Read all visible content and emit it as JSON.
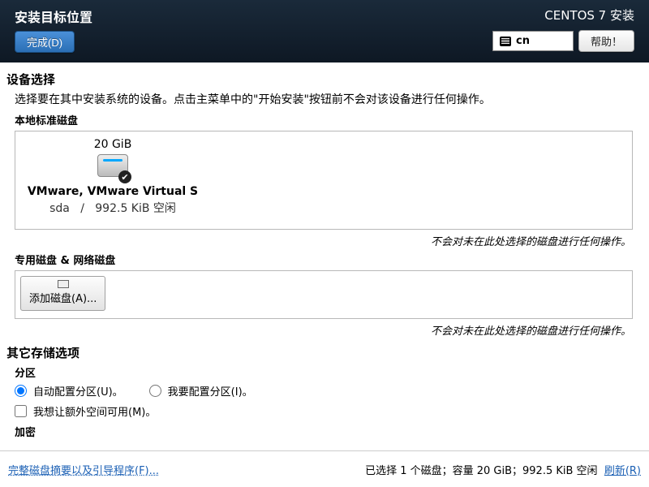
{
  "header": {
    "title": "安装目标位置",
    "done_btn": "完成(D)",
    "product": "CENTOS 7 安装",
    "lang": "cn",
    "help_btn": "帮助！"
  },
  "device_selection": {
    "heading": "设备选择",
    "instruction": "选择要在其中安装系统的设备。点击主菜单中的\"开始安装\"按钮前不会对该设备进行任何操作。",
    "local_heading": "本地标准磁盘",
    "disk": {
      "size": "20 GiB",
      "name": "VMware, VMware Virtual S",
      "dev": "sda",
      "sep": "/",
      "free": "992.5 KiB 空闲"
    },
    "note": "不会对未在此处选择的磁盘进行任何操作。",
    "special_heading": "专用磁盘 & 网络磁盘",
    "add_disk": "添加磁盘(A)..."
  },
  "other_options": {
    "heading": "其它存储选项",
    "partition_heading": "分区",
    "auto_partition": "自动配置分区(U)。",
    "manual_partition": "我要配置分区(I)。",
    "extra_space": "我想让额外空间可用(M)。",
    "encryption_heading": "加密"
  },
  "footer": {
    "summary_link": "完整磁盘摘要以及引导程序(F)...",
    "status": "已选择 1 个磁盘；容量 20 GiB；992.5 KiB 空闲",
    "refresh": "刷新(R)"
  }
}
